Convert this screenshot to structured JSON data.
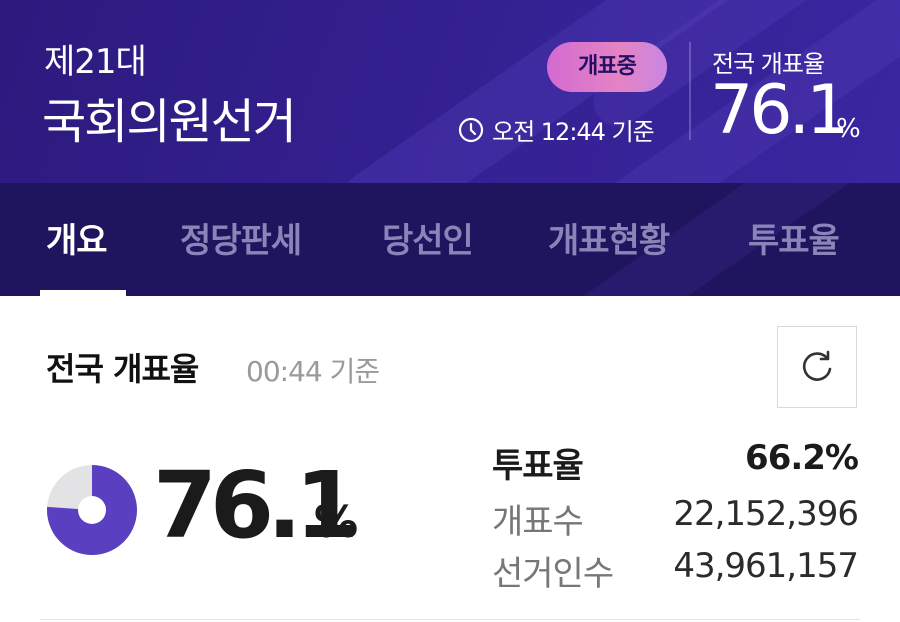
{
  "header": {
    "subtitle": "제21대",
    "title": "국회의원선거",
    "live_badge": "개표중",
    "time_text": "오전 12:44 기준",
    "rate_label": "전국 개표율",
    "rate_value": "76.1",
    "rate_unit": "%"
  },
  "tabs": [
    {
      "label": "개요",
      "active": true
    },
    {
      "label": "정당판세",
      "active": false
    },
    {
      "label": "당선인",
      "active": false
    },
    {
      "label": "개표현황",
      "active": false
    },
    {
      "label": "투표율",
      "active": false
    }
  ],
  "summary": {
    "title": "전국 개표율",
    "time": "00:44 기준",
    "refresh_icon": "refresh-icon",
    "rate_value": "76.1",
    "rate_unit": "%",
    "counted_fraction": 0.761,
    "stats": [
      {
        "label": "투표율",
        "value": "66.2%",
        "bold": true
      },
      {
        "label": "개표수",
        "value": "22,152,396",
        "bold": false
      },
      {
        "label": "선거인수",
        "value": "43,961,157",
        "bold": false
      }
    ]
  },
  "colors": {
    "header_bg": "#33208f",
    "tabs_bg": "#1f145e",
    "donut_fill": "#5a3fc0",
    "donut_empty": "#e3e3e6",
    "badge": "#e583c3"
  }
}
